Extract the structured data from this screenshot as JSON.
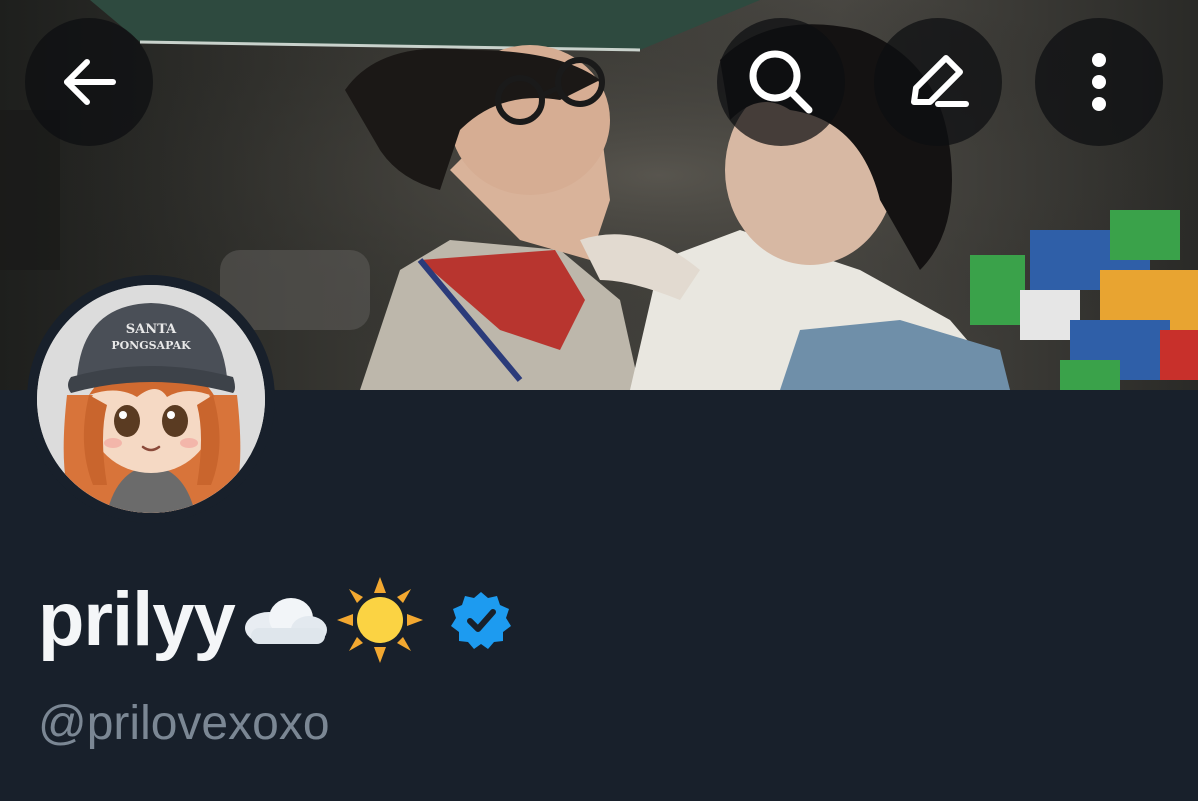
{
  "profile": {
    "display_name": "prilyy",
    "name_emojis": [
      "cloud-emoji",
      "sun-emoji"
    ],
    "verified": true,
    "handle": "@prilovexoxo",
    "avatar_cap_text_line1": "SANTA",
    "avatar_cap_text_line2": "PONGSAPAK"
  },
  "header": {
    "back_icon": "arrow-left-icon",
    "search_icon": "search-icon",
    "edit_icon": "pencil-icon",
    "more_icon": "more-vertical-icon"
  },
  "colors": {
    "background": "#18202b",
    "name_text": "#f4f6f8",
    "handle_text": "#7b8794",
    "verified_badge": "#1d9bf0",
    "button_bg": "rgba(12, 14, 16, 0.72)"
  }
}
